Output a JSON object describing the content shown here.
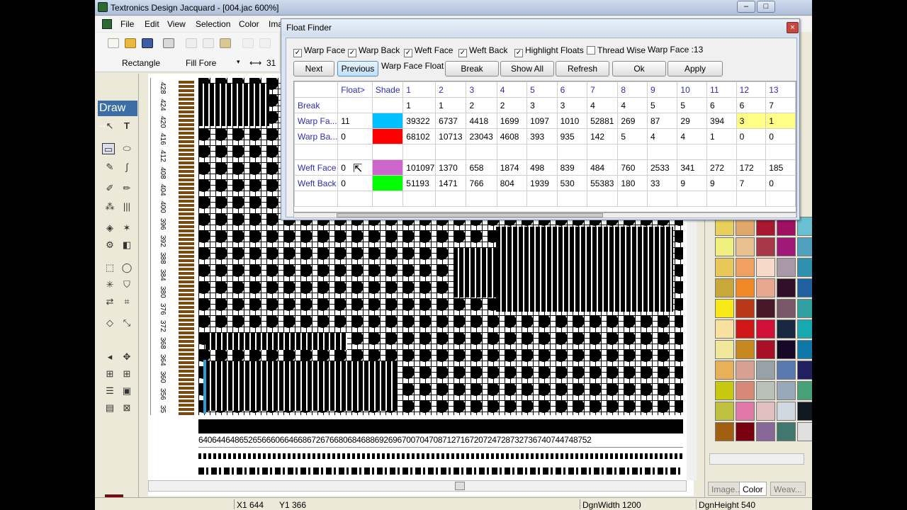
{
  "window": {
    "title": "Textronics Design Jacquard - [004.jac 600%]"
  },
  "menu": [
    "File",
    "Edit",
    "View",
    "Selection",
    "Color",
    "Ima"
  ],
  "toolbar": {
    "shape_label": "Rectangle",
    "fill_label": "Fill Fore",
    "fill_arrow": "▾",
    "size_icon_label": "⟷",
    "size_value": "31"
  },
  "tools": {
    "panel_title": "Draw ..."
  },
  "ruler": [
    "428",
    "424",
    "420",
    "416",
    "412",
    "408",
    "404",
    "400",
    "396",
    "392",
    "388",
    "384",
    "380",
    "376",
    "372",
    "368",
    "364",
    "360",
    "356",
    "35"
  ],
  "number_strip": "640644648652656660664668672676680684688692696700704708712716720724728732736740744748752",
  "palette": {
    "colors": [
      "#e8d05a",
      "#e0a86a",
      "#a81830",
      "#a01060",
      "#68c0d0",
      "#f0f080",
      "#e8c090",
      "#a83848",
      "#a01878",
      "#50a0c0",
      "#e8c858",
      "#f0a060",
      "#f8d8c8",
      "#a898a8",
      "#3090b0",
      "#c8a838",
      "#f08828",
      "#e8a890",
      "#301028",
      "#2060a0",
      "#f8e818",
      "#b83818",
      "#481828",
      "#785868",
      "#30a0a0",
      "#f8e0a0",
      "#d01818",
      "#d01038",
      "#182840",
      "#18a8b0",
      "#f0e898",
      "#c88820",
      "#a81028",
      "#180828",
      "#1078a8",
      "#e8b058",
      "#d8a090",
      "#98a0a8",
      "#5878b0",
      "#202060",
      "#c8c810",
      "#d88878",
      "#b8c0b8",
      "#98a8b8",
      "#48a078",
      "#c0c040",
      "#e078a8",
      "#e0c0c0",
      "#d0d8e0",
      "#101820",
      "#a06010",
      "#780010",
      "#886898",
      "#407870",
      "#e0e0e0"
    ]
  },
  "panel_tabs": [
    "Image...",
    "Color",
    "Weav..."
  ],
  "status": {
    "x": "X1  644",
    "y": "Y1  366",
    "dgn_width": "DgnWidth  1200",
    "dgn_height": "DgnHeight  540"
  },
  "dialog": {
    "title": "Float Finder",
    "close": "×",
    "checkboxes": [
      {
        "label": "Warp Face",
        "checked": true
      },
      {
        "label": "Warp Back",
        "checked": true
      },
      {
        "label": "Weft Face",
        "checked": true
      },
      {
        "label": "Weft Back",
        "checked": true
      },
      {
        "label": "Highlight Floats",
        "checked": true
      },
      {
        "label": "Thread Wise",
        "checked": false
      }
    ],
    "check_mark": "✓",
    "status_text": "Warp Face :13",
    "float_type_label": "Warp Face Float",
    "buttons": {
      "next": "Next",
      "previous": "Previous",
      "break": "Break",
      "show_all": "Show All",
      "refresh": "Refresh",
      "ok": "Ok",
      "apply": "Apply"
    },
    "table": {
      "headers": [
        "",
        "Float>",
        "Shade",
        "1",
        "2",
        "3",
        "4",
        "5",
        "6",
        "7",
        "8",
        "9",
        "10",
        "11",
        "12",
        "13"
      ],
      "rows": [
        {
          "label": "Break",
          "float": "",
          "shade": "",
          "values": [
            "1",
            "1",
            "2",
            "2",
            "3",
            "3",
            "4",
            "4",
            "5",
            "5",
            "6",
            "6",
            "7"
          ]
        },
        {
          "label": "Warp Fa...",
          "float": "11",
          "shade": "#00c0ff",
          "values": [
            "39322",
            "6737",
            "4418",
            "1699",
            "1097",
            "1010",
            "52881",
            "269",
            "87",
            "29",
            "394",
            "3",
            "1"
          ]
        },
        {
          "label": "Warp Ba...",
          "float": "0",
          "shade": "#ff0000",
          "values": [
            "68102",
            "10713",
            "23043",
            "4608",
            "393",
            "935",
            "142",
            "5",
            "4",
            "4",
            "1",
            "0",
            "0"
          ]
        },
        {
          "label": "",
          "float": "",
          "shade": "",
          "values": [
            "",
            "",
            "",
            "",
            "",
            "",
            "",
            "",
            "",
            "",
            "",
            "",
            ""
          ]
        },
        {
          "label": "Weft Face",
          "float": "0",
          "shade": "#cc66cc",
          "values": [
            "101097",
            "1370",
            "658",
            "1874",
            "498",
            "839",
            "484",
            "760",
            "2533",
            "341",
            "272",
            "172",
            "185"
          ]
        },
        {
          "label": "Weft Back",
          "float": "0",
          "shade": "#00ff00",
          "values": [
            "51193",
            "1471",
            "766",
            "804",
            "1939",
            "530",
            "55383",
            "180",
            "33",
            "9",
            "9",
            "7",
            "0"
          ]
        },
        {
          "label": "",
          "float": "",
          "shade": "",
          "values": [
            "",
            "",
            "",
            "",
            "",
            "",
            "",
            "",
            "",
            "",
            "",
            "",
            ""
          ]
        }
      ]
    }
  }
}
